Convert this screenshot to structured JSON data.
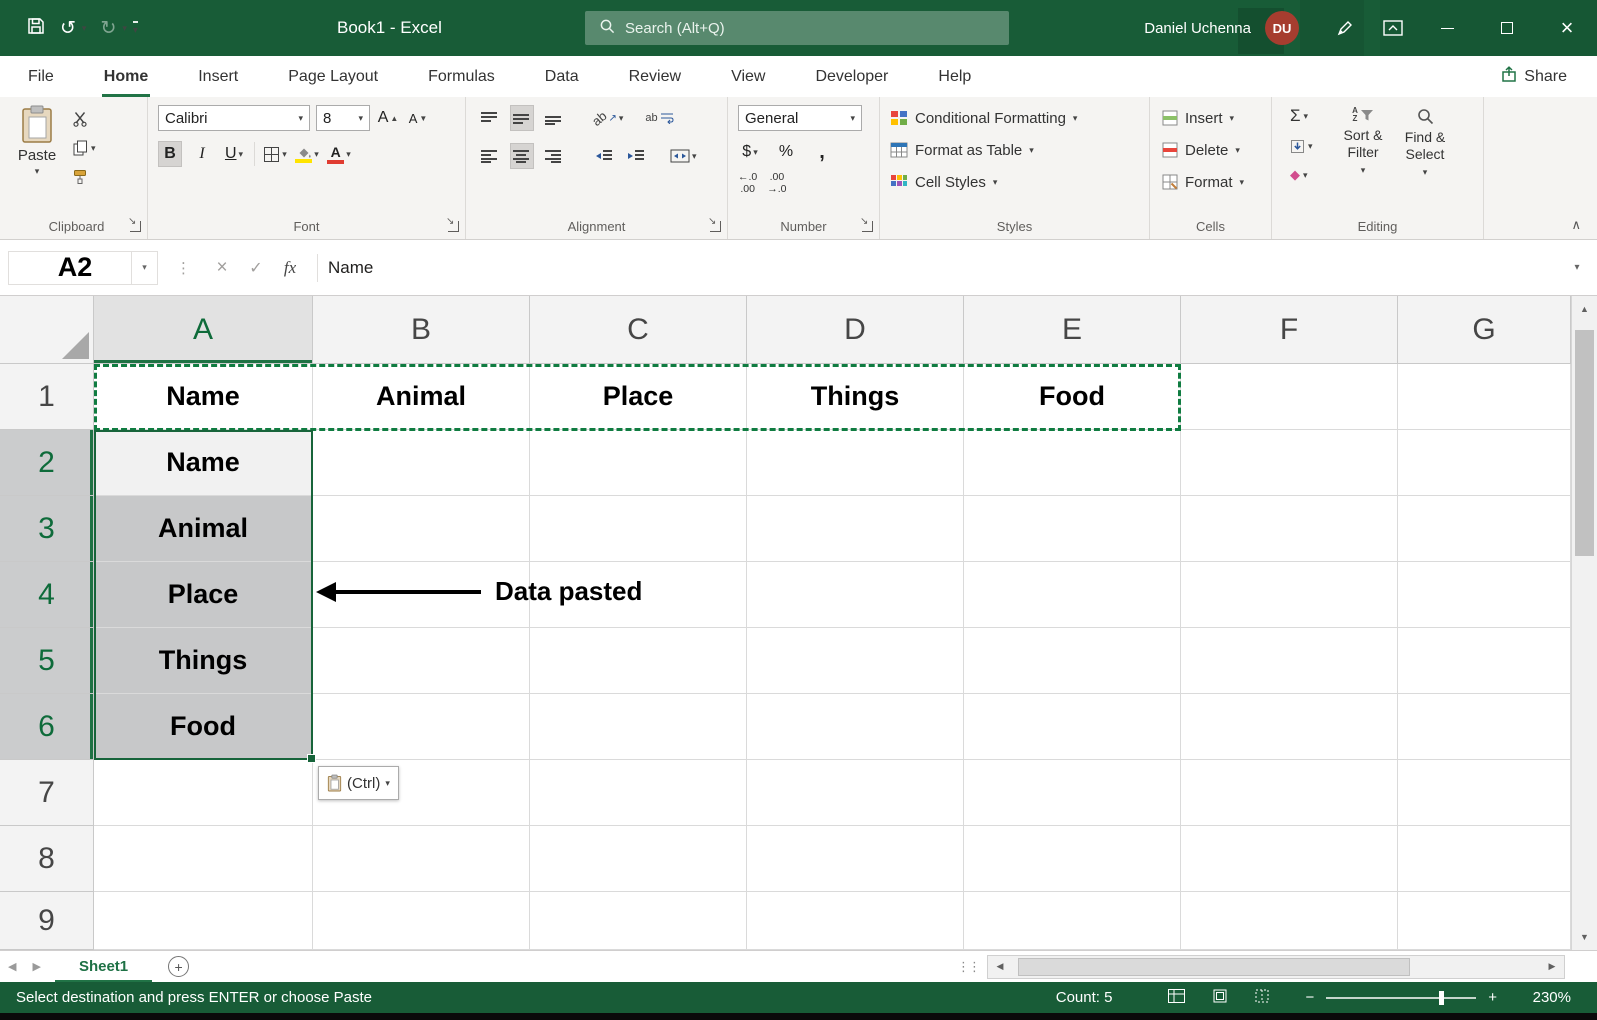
{
  "colors": {
    "excel_green": "#185C37",
    "accent_green": "#217346",
    "selection_border_green": "#17643A",
    "selection_fill_gray": "#C7C8C9",
    "avatar_red": "#A63D2F",
    "fill_color_swatch": "#FFE400",
    "font_color_swatch": "#E03C31"
  },
  "icons": {
    "caret_down": "▾",
    "undo": "↺",
    "redo": "↻",
    "check": "✓",
    "cancel": "×",
    "dots_vertical": "⋮",
    "drag_dots": "⋮⋮",
    "collapse_ribbon": "∧",
    "scroll_left": "◀",
    "scroll_right": "▶",
    "scroll_up": "▲",
    "scroll_down": "▼",
    "minus": "−",
    "plus": "+",
    "add_sheet": "+",
    "eraser_diamond": "◆",
    "sigma": "Σ",
    "arrow_up_right": "↗"
  },
  "title_bar": {
    "title": "Book1  -  Excel",
    "search_placeholder": "Search (Alt+Q)",
    "user_name": "Daniel Uchenna",
    "user_initials": "DU"
  },
  "menu_bar": {
    "tabs": [
      "File",
      "Home",
      "Insert",
      "Page Layout",
      "Formulas",
      "Data",
      "Review",
      "View",
      "Developer",
      "Help"
    ],
    "active_tab": "Home",
    "share_label": "Share"
  },
  "ribbon": {
    "clipboard": {
      "group_label": "Clipboard",
      "paste_label": "Paste"
    },
    "font": {
      "group_label": "Font",
      "font_name": "Calibri",
      "font_size": "8",
      "bold": "B",
      "italic": "I",
      "underline": "U",
      "grow_letter": "A",
      "shrink_letter": "A",
      "font_color_letter": "A"
    },
    "alignment": {
      "group_label": "Alignment",
      "orientation_label": "ab",
      "wrap_label": "ab"
    },
    "number": {
      "group_label": "Number",
      "format_value": "General",
      "currency": "$",
      "percent": "%",
      "comma": ",",
      "increase_decimal_top": "←.0",
      "increase_decimal_bottom": ".00",
      "decrease_decimal_top": ".00",
      "decrease_decimal_bottom": "→.0"
    },
    "styles": {
      "group_label": "Styles",
      "conditional_formatting": "Conditional Formatting",
      "format_as_table": "Format as Table",
      "cell_styles": "Cell Styles"
    },
    "cells": {
      "group_label": "Cells",
      "insert": "Insert",
      "delete": "Delete",
      "format": "Format"
    },
    "editing": {
      "group_label": "Editing",
      "sort_filter": "Sort & Filter",
      "find_select": "Find & Select",
      "az_top": "A",
      "az_bottom": "Z"
    }
  },
  "formula_bar": {
    "name_box": "A2",
    "fx_label": "fx",
    "value": "Name"
  },
  "grid": {
    "column_headers": [
      "A",
      "B",
      "C",
      "D",
      "E",
      "F",
      "G"
    ],
    "row_headers": [
      "1",
      "2",
      "3",
      "4",
      "5",
      "6",
      "7",
      "8",
      "9"
    ],
    "copied_row_values": [
      "Name",
      "Animal",
      "Place",
      "Things",
      "Food"
    ],
    "pasted_column_values": [
      "Name",
      "Animal",
      "Place",
      "Things",
      "Food"
    ],
    "annotation_text": "Data pasted",
    "paste_options_label": "(Ctrl)"
  },
  "sheet_bar": {
    "sheet_name": "Sheet1"
  },
  "status_bar": {
    "message": "Select destination and press ENTER or choose Paste",
    "count": "Count: 5",
    "zoom": "230%"
  }
}
